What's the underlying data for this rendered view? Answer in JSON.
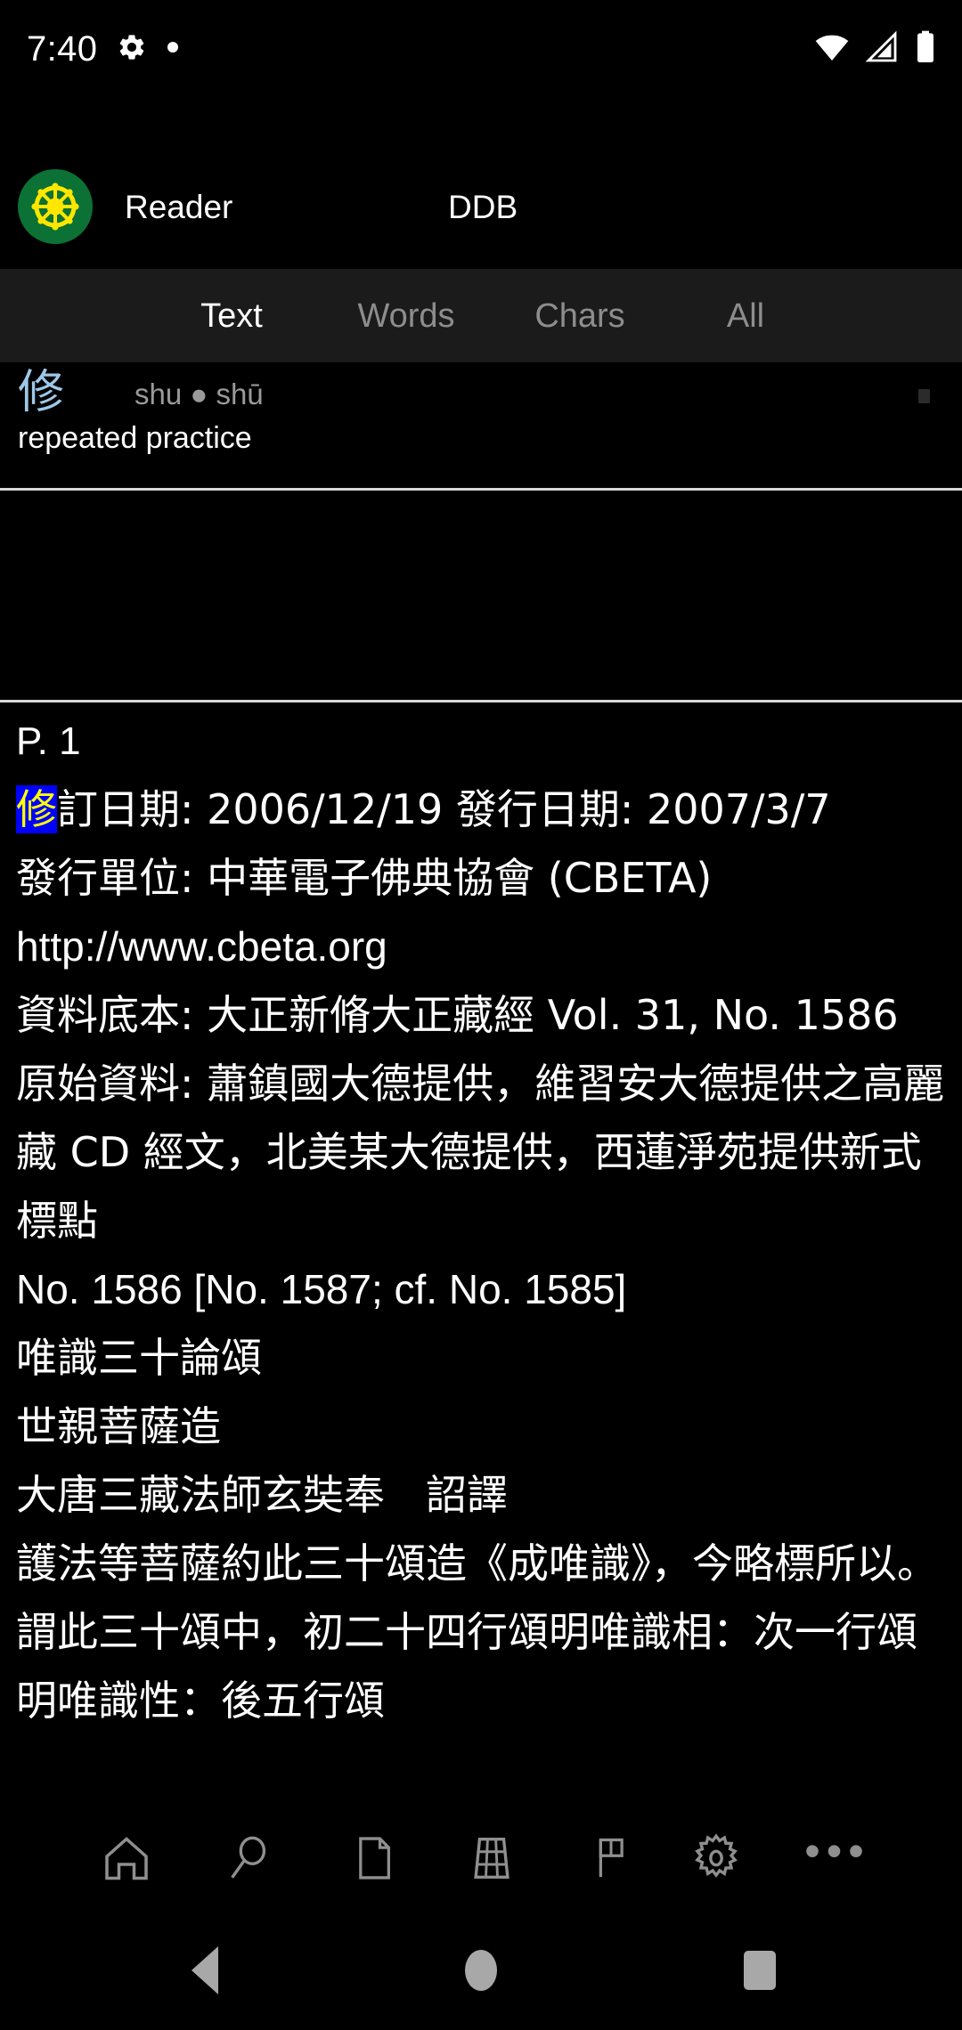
{
  "status_bar": {
    "time": "7:40",
    "icons": [
      "gear-icon",
      "dot-icon",
      "wifi-icon",
      "cellular-signal-icon",
      "battery-icon"
    ]
  },
  "app_header": {
    "logo": "dharma-wheel-logo",
    "app_name": "Reader",
    "ddb_label": "DDB",
    "logo_bg_color": "#0b7135",
    "logo_wheel_color": "#ffe600"
  },
  "segment_tabs": {
    "active_index": 0,
    "items": [
      {
        "label": "Text"
      },
      {
        "label": "Words"
      },
      {
        "label": "Chars"
      },
      {
        "label": "All"
      }
    ],
    "active_color": "#ffffff",
    "inactive_color": "#8d8d8d",
    "bar_bg_color": "#1b1b1b"
  },
  "dictionary": {
    "headword": "修",
    "headword_color": "#9ec8e8",
    "pronunciation": "shu ● shū",
    "gloss": "repeated practice"
  },
  "text_body": {
    "page_label": "P. 1",
    "highlight_char": "修",
    "highlight_bg_color": "#0000ff",
    "highlight_text_color": "#ffff00",
    "paragraphs": [
      {
        "id": "revision-line",
        "prefix": "修",
        "text": "訂日期: 2006/12/19 發行日期: 2007/3/7",
        "highlighted": true
      },
      {
        "id": "publisher-line",
        "text": "發行單位: 中華電子佛典協會 (CBETA)",
        "highlighted": false
      },
      {
        "id": "url-line",
        "text": "http://www.cbeta.org",
        "highlighted": false,
        "latin": true
      },
      {
        "id": "source-line",
        "text": "資料底本: 大正新脩大正藏經 Vol. 31, No. 1586",
        "highlighted": false
      },
      {
        "id": "original-data-line",
        "text": "原始資料: 蕭鎮國大德提供，維習安大德提供之高麗藏 CD 經文，北美某大德提供，西蓮淨苑提供新式標點",
        "highlighted": false
      },
      {
        "id": "number-line",
        "text": "No. 1586 [No. 1587; cf. No. 1585]",
        "highlighted": false,
        "latin": true
      },
      {
        "id": "title-line",
        "text": "唯識三十論頌",
        "highlighted": false
      },
      {
        "id": "author-line",
        "text": "世親菩薩造",
        "highlighted": false
      },
      {
        "id": "translator-line",
        "text": "大唐三藏法師玄奘奉　詔譯",
        "highlighted": false
      },
      {
        "id": "body-line",
        "text": "護法等菩薩約此三十頌造《成唯識》，今略標所以。謂此三十頌中，初二十四行頌明唯識相：次一行頌明唯識性：後五行頌",
        "highlighted": false
      }
    ]
  },
  "toolbar": {
    "buttons": [
      {
        "icon": "home-icon",
        "name": "home-button"
      },
      {
        "icon": "search-icon",
        "name": "search-button"
      },
      {
        "icon": "document-icon",
        "name": "document-button"
      },
      {
        "icon": "table-icon",
        "name": "table-button"
      },
      {
        "icon": "flag-icon",
        "name": "flag-button"
      },
      {
        "icon": "gear-icon",
        "name": "settings-button"
      },
      {
        "icon": "overflow-icon",
        "name": "more-button",
        "label": "•••"
      }
    ]
  },
  "nav_bar": {
    "back": "back-triangle",
    "home": "home-circle",
    "recents": "recents-square"
  }
}
